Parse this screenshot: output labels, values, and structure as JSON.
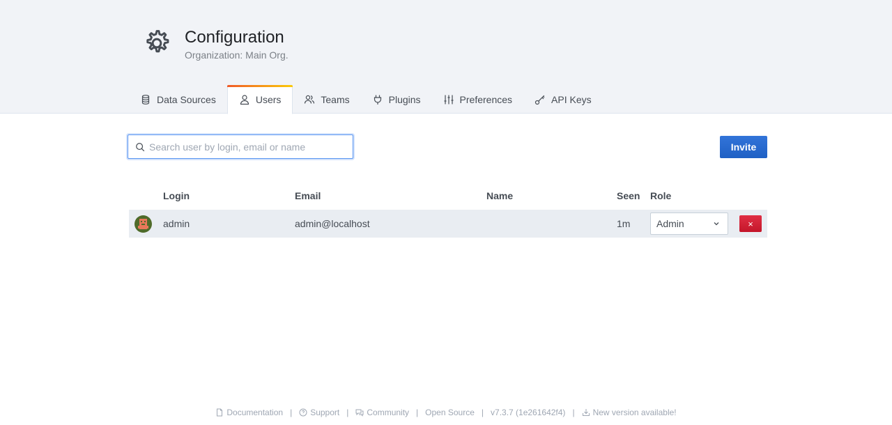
{
  "header": {
    "title": "Configuration",
    "subtitle": "Organization: Main Org.",
    "icon": "gear-icon"
  },
  "tabs": [
    {
      "label": "Data Sources",
      "icon": "database-icon",
      "active": false
    },
    {
      "label": "Users",
      "icon": "user-icon",
      "active": true
    },
    {
      "label": "Teams",
      "icon": "users-icon",
      "active": false
    },
    {
      "label": "Plugins",
      "icon": "plug-icon",
      "active": false
    },
    {
      "label": "Preferences",
      "icon": "sliders-icon",
      "active": false
    },
    {
      "label": "API Keys",
      "icon": "key-icon",
      "active": false
    }
  ],
  "search": {
    "placeholder": "Search user by login, email or name",
    "value": ""
  },
  "invite_label": "Invite",
  "table": {
    "columns": [
      "Login",
      "Email",
      "Name",
      "Seen",
      "Role"
    ],
    "rows": [
      {
        "login": "admin",
        "email": "admin@localhost",
        "name": "",
        "seen": "1m",
        "role": "Admin",
        "delete_label": "×"
      }
    ]
  },
  "footer": {
    "links": [
      {
        "label": "Documentation",
        "icon": "document-icon"
      },
      {
        "label": "Support",
        "icon": "question-icon"
      },
      {
        "label": "Community",
        "icon": "comments-icon"
      },
      {
        "label": "Open Source",
        "icon": ""
      },
      {
        "label": "v7.3.7 (1e261642f4)",
        "icon": ""
      },
      {
        "label": "New version available!",
        "icon": "download-icon"
      }
    ],
    "separator": "|"
  },
  "colors": {
    "accent_blue": "#1f60c4",
    "danger_red": "#c4162a",
    "tab_gradient_start": "#f05a28",
    "tab_gradient_end": "#fbca0a"
  }
}
